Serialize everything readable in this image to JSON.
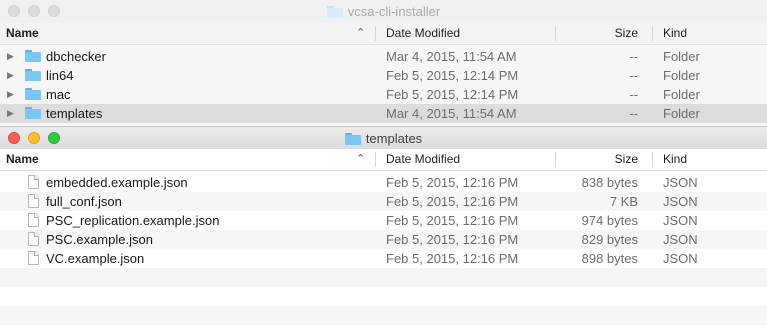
{
  "back_window": {
    "title": "vcsa-cli-installer",
    "columns": {
      "name": "Name",
      "date": "Date Modified",
      "size": "Size",
      "kind": "Kind"
    },
    "rows": [
      {
        "name": "dbchecker",
        "date": "Mar 4, 2015, 11:54 AM",
        "size": "--",
        "kind": "Folder"
      },
      {
        "name": "lin64",
        "date": "Feb 5, 2015, 12:14 PM",
        "size": "--",
        "kind": "Folder"
      },
      {
        "name": "mac",
        "date": "Feb 5, 2015, 12:14 PM",
        "size": "--",
        "kind": "Folder"
      },
      {
        "name": "templates",
        "date": "Mar 4, 2015, 11:54 AM",
        "size": "--",
        "kind": "Folder"
      }
    ]
  },
  "front_window": {
    "title": "templates",
    "columns": {
      "name": "Name",
      "date": "Date Modified",
      "size": "Size",
      "kind": "Kind"
    },
    "rows": [
      {
        "name": "embedded.example.json",
        "date": "Feb 5, 2015, 12:16 PM",
        "size": "838 bytes",
        "kind": "JSON"
      },
      {
        "name": "full_conf.json",
        "date": "Feb 5, 2015, 12:16 PM",
        "size": "7 KB",
        "kind": "JSON"
      },
      {
        "name": "PSC_replication.example.json",
        "date": "Feb 5, 2015, 12:16 PM",
        "size": "974 bytes",
        "kind": "JSON"
      },
      {
        "name": "PSC.example.json",
        "date": "Feb 5, 2015, 12:16 PM",
        "size": "829 bytes",
        "kind": "JSON"
      },
      {
        "name": "VC.example.json",
        "date": "Feb 5, 2015, 12:16 PM",
        "size": "898 bytes",
        "kind": "JSON"
      }
    ]
  },
  "icons": {
    "expand": "disclosure-triangle-icon",
    "folder": "folder-icon",
    "file": "document-icon",
    "sort": "chevron-up-icon"
  },
  "colors": {
    "folder": "#7cc6f5",
    "close": "#fc5f57",
    "minimize": "#fdbc2e",
    "zoom": "#33c748",
    "selection": "#dcdcdc"
  }
}
